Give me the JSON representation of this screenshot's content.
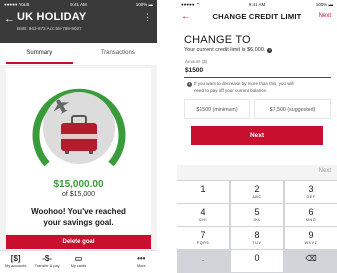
{
  "left_screen": {
    "status_bar": {
      "carrier": "●●●●● YoLB",
      "time": "9:41 AM",
      "battery": "100% ▬"
    },
    "header": {
      "back_icon": "arrow-left-icon",
      "title": "UK HOLIDAY",
      "subtitle": "BSB: 943-873  Acc:58-789-9027",
      "menu_icon": "vertical-dots-icon"
    },
    "tabs": [
      {
        "label": "Summary",
        "selected": true
      },
      {
        "label": "Transactions",
        "selected": false
      }
    ],
    "goal": {
      "amount": "$15,000.00",
      "of_label": "of $15,000",
      "progress_fraction": 1.0,
      "message_line1": "Woohoo! You've reached",
      "message_line2": "your savings goal."
    },
    "delete_button_label": "Delete goal",
    "bottom_nav": [
      {
        "icon_text": "[$]",
        "label": "My accounts"
      },
      {
        "icon_text": "-$-",
        "label": "Transfer & pay"
      },
      {
        "icon_text": "▭",
        "label": "My cards"
      },
      {
        "icon_text": "•••",
        "label": "More"
      }
    ]
  },
  "right_screen": {
    "status_bar": {
      "carrier": "●●●●● ⌔",
      "time": "9:41 AM",
      "battery": "100% ▬"
    },
    "header": {
      "back_icon": "arrow-left-icon",
      "title": "CHANGE CREDIT LIMIT",
      "next_label": "Next"
    },
    "heading": "CHANGE TO",
    "current_limit_text": "Your current credit limit is $6,000.",
    "amount_field": {
      "label": "Amount ($)",
      "value": "$1500"
    },
    "warning_line1": "If you want to decrease by more than this, you will",
    "warning_line2": "need to pay off your current balance.",
    "chips": [
      "$1500 (minimum)",
      "$7,500 (suggested)"
    ],
    "next_button_label": "Next",
    "keypad": {
      "top_next_label": "Next",
      "keys": [
        {
          "digit": "1",
          "letters": ""
        },
        {
          "digit": "2",
          "letters": "ABC"
        },
        {
          "digit": "3",
          "letters": "DEF"
        },
        {
          "digit": "4",
          "letters": "GHI"
        },
        {
          "digit": "5",
          "letters": "JKL"
        },
        {
          "digit": "6",
          "letters": "MNO"
        },
        {
          "digit": "7",
          "letters": "PQRS"
        },
        {
          "digit": "8",
          "letters": "TUV"
        },
        {
          "digit": "9",
          "letters": "WXYZ"
        },
        {
          "digit": ".",
          "letters": ""
        },
        {
          "digit": "0",
          "letters": ""
        },
        {
          "digit": "⌫",
          "letters": ""
        }
      ]
    }
  },
  "colors": {
    "brand_red": "#c8102e",
    "success_green": "#3a9b3a",
    "header_dark": "#3a3a3a"
  }
}
